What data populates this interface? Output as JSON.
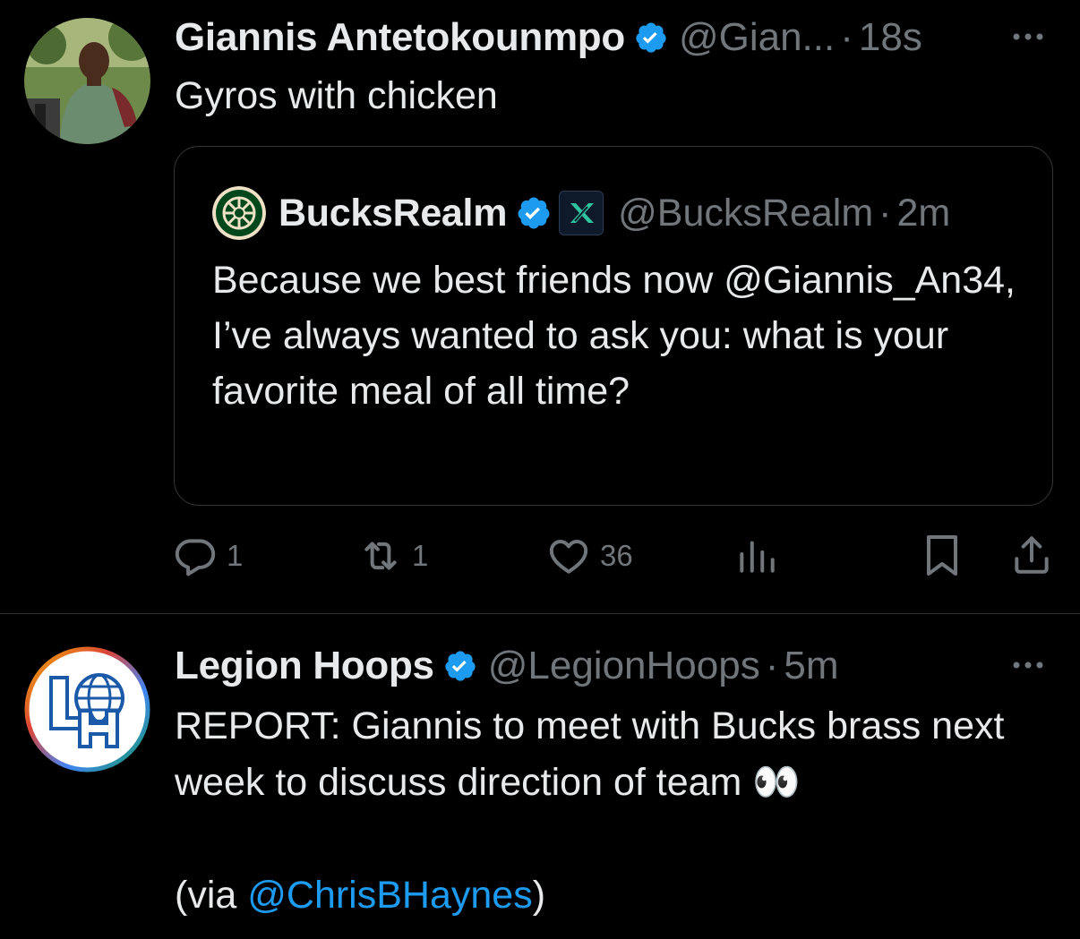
{
  "tweets": [
    {
      "author": "Giannis Antetokounmpo",
      "handle": "@Gian...",
      "time": "18s",
      "text": "Gyros with chicken",
      "quote": {
        "author": "BucksRealm",
        "handle": "@BucksRealm",
        "time": "2m",
        "text": "Because we best friends now @Giannis_An34, I’ve always wanted to ask you: what is your favorite meal of all time?"
      },
      "stats": {
        "replies": "1",
        "reposts": "1",
        "likes": "36"
      }
    },
    {
      "author": "Legion Hoops",
      "handle": "@LegionHoops",
      "time": "5m",
      "text_line1": "REPORT: Giannis to meet with Bucks brass next week to discuss direction of team",
      "emoji": "👀",
      "via_prefix": "(via ",
      "via_link": "@ChrisBHaynes",
      "via_suffix": ")"
    }
  ],
  "separator": "·",
  "colors": {
    "background": "#000000",
    "text": "#e7e9ea",
    "muted": "#71767b",
    "link": "#1d9bf0",
    "verified": "#1d9bf0",
    "border": "#2f3336"
  },
  "icons": [
    "more-icon",
    "verified-icon",
    "reply-icon",
    "repost-icon",
    "like-icon",
    "views-icon",
    "bookmark-icon",
    "share-icon"
  ]
}
